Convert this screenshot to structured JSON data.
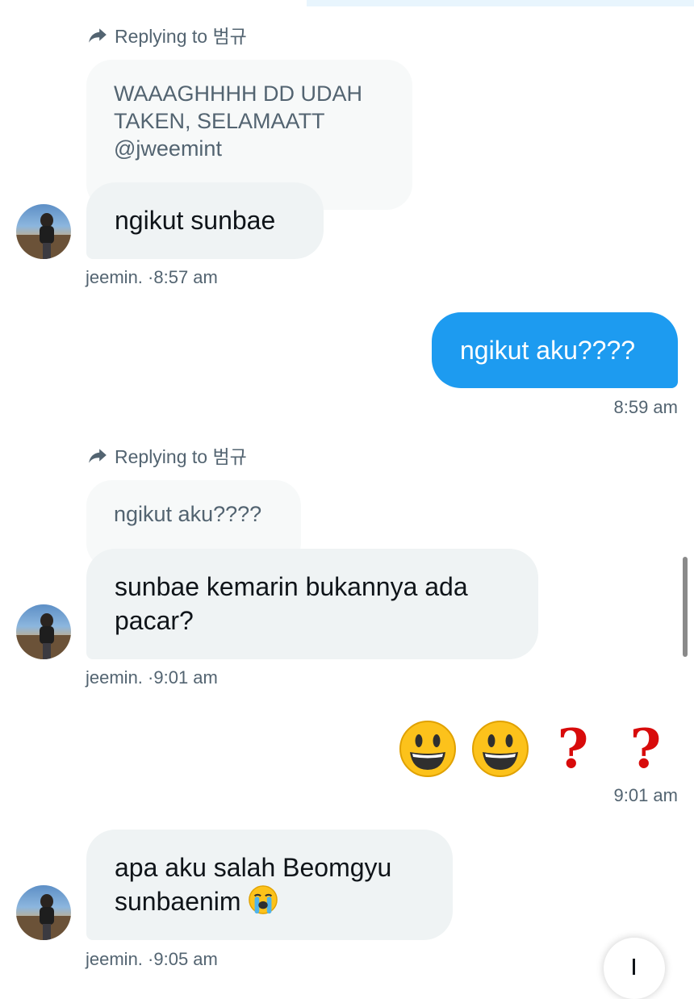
{
  "messages": [
    {
      "reply_label": "Replying to 범규",
      "quoted_text": "WAAAGHHHH DD UDAH TAKEN, SELAMAATT @jweemint",
      "text": "ngikut sunbae",
      "sender": "jeemin.",
      "time": "·8:57 am"
    },
    {
      "text": "ngikut aku????",
      "time": "8:59 am"
    },
    {
      "reply_label": "Replying to 범규",
      "quoted_text": "ngikut aku????",
      "text": "sunbae kemarin bukannya ada pacar?",
      "sender": "jeemin.",
      "time": "·9:01 am"
    },
    {
      "emojis": [
        "grinning-face",
        "grinning-face",
        "red-question-mark",
        "red-question-mark"
      ],
      "question_glyph": "?",
      "time": "9:01 am"
    },
    {
      "text": "apa aku salah Beomgyu sunbaenim",
      "emoji": "loudly-crying-face",
      "sender": "jeemin.",
      "time": "·9:05 am"
    }
  ],
  "colors": {
    "outgoing_bubble": "#1d9bf0",
    "incoming_bubble": "#eff3f4",
    "quoted_bubble": "#f7f9f9",
    "meta_text": "#536471"
  }
}
